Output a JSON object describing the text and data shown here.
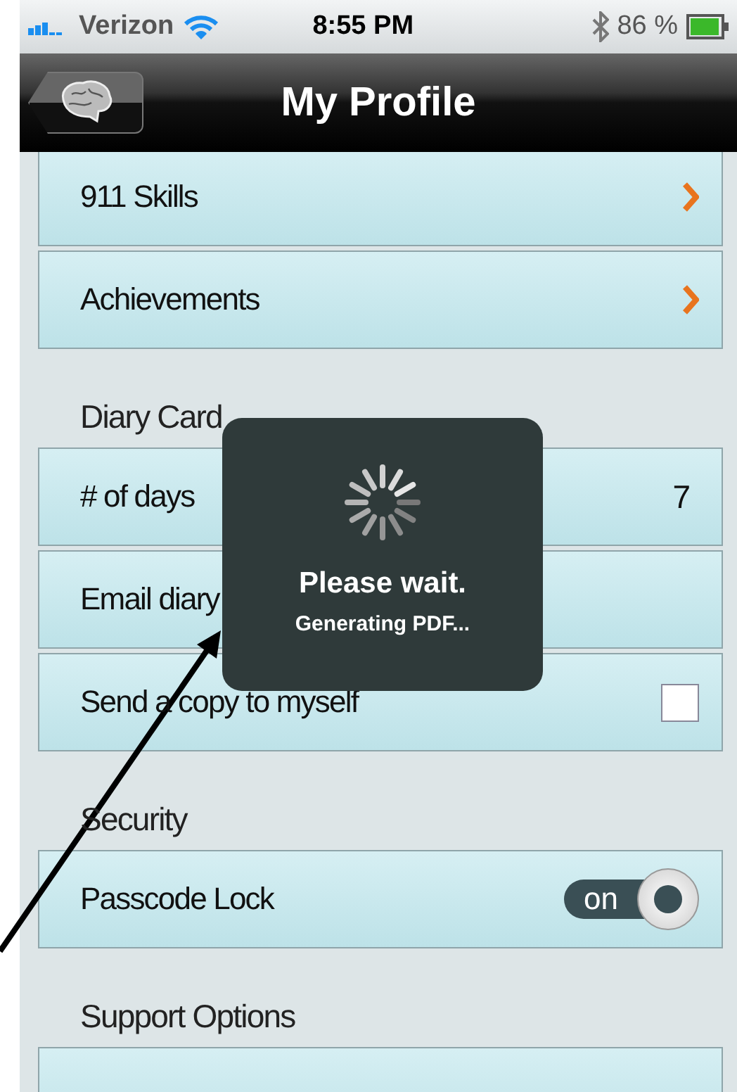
{
  "status_bar": {
    "carrier": "Verizon",
    "time": "8:55 PM",
    "battery": "86 %"
  },
  "nav": {
    "title": "My Profile"
  },
  "sections": [
    {
      "items": [
        {
          "kind": "disclosure",
          "label": "911 Skills"
        },
        {
          "kind": "disclosure",
          "label": "Achievements"
        }
      ]
    },
    {
      "header": "Diary Card",
      "items": [
        {
          "kind": "value",
          "label": "# of days",
          "value": "7"
        },
        {
          "kind": "plain",
          "label": "Email diary"
        },
        {
          "kind": "checkbox",
          "label": "Send a copy to myself",
          "checked": false
        }
      ]
    },
    {
      "header": "Security",
      "items": [
        {
          "kind": "toggle",
          "label": "Passcode Lock",
          "on": true,
          "state_label": "on"
        }
      ]
    },
    {
      "header": "Support Options",
      "items": [
        {
          "kind": "plain"
        }
      ]
    }
  ],
  "hud": {
    "title": "Please wait.",
    "message": "Generating PDF..."
  }
}
